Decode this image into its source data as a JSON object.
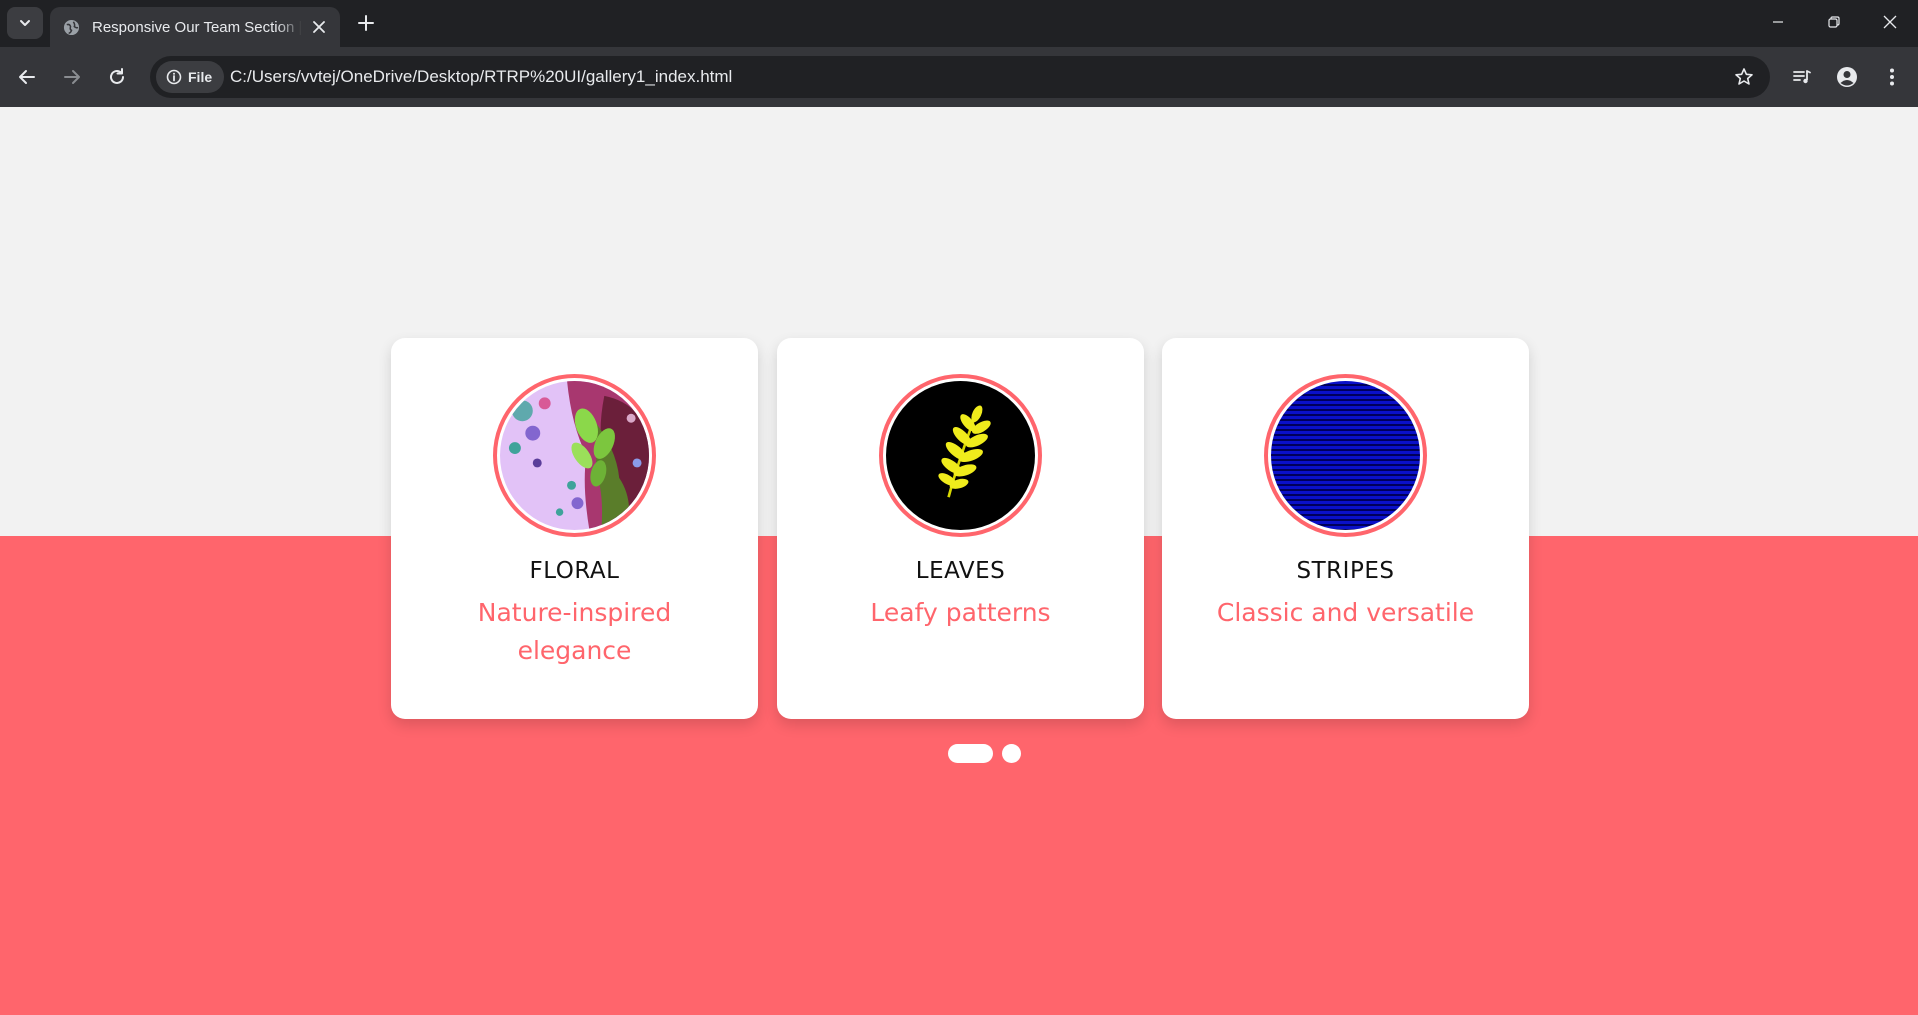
{
  "browser": {
    "tab": {
      "title": "Responsive Our Team Section | C"
    },
    "site_chip_label": "File",
    "url": "C:/Users/vvtej/OneDrive/Desktop/RTRP%20UI/gallery1_index.html"
  },
  "colors": {
    "accent": "#ff656c",
    "page_background": "#f2f2f2",
    "card_background": "#ffffff"
  },
  "cards": [
    {
      "title": "FLORAL",
      "subtitle": "Nature-inspired elegance",
      "image": "fractal-floral-pattern"
    },
    {
      "title": "LEAVES",
      "subtitle": "Leafy patterns",
      "image": "yellow-fern-leaf-on-black"
    },
    {
      "title": "STRIPES",
      "subtitle": "Classic and versatile",
      "image": "blue-horizontal-stripes"
    }
  ],
  "pager": {
    "active_index": 0,
    "count": 2
  }
}
